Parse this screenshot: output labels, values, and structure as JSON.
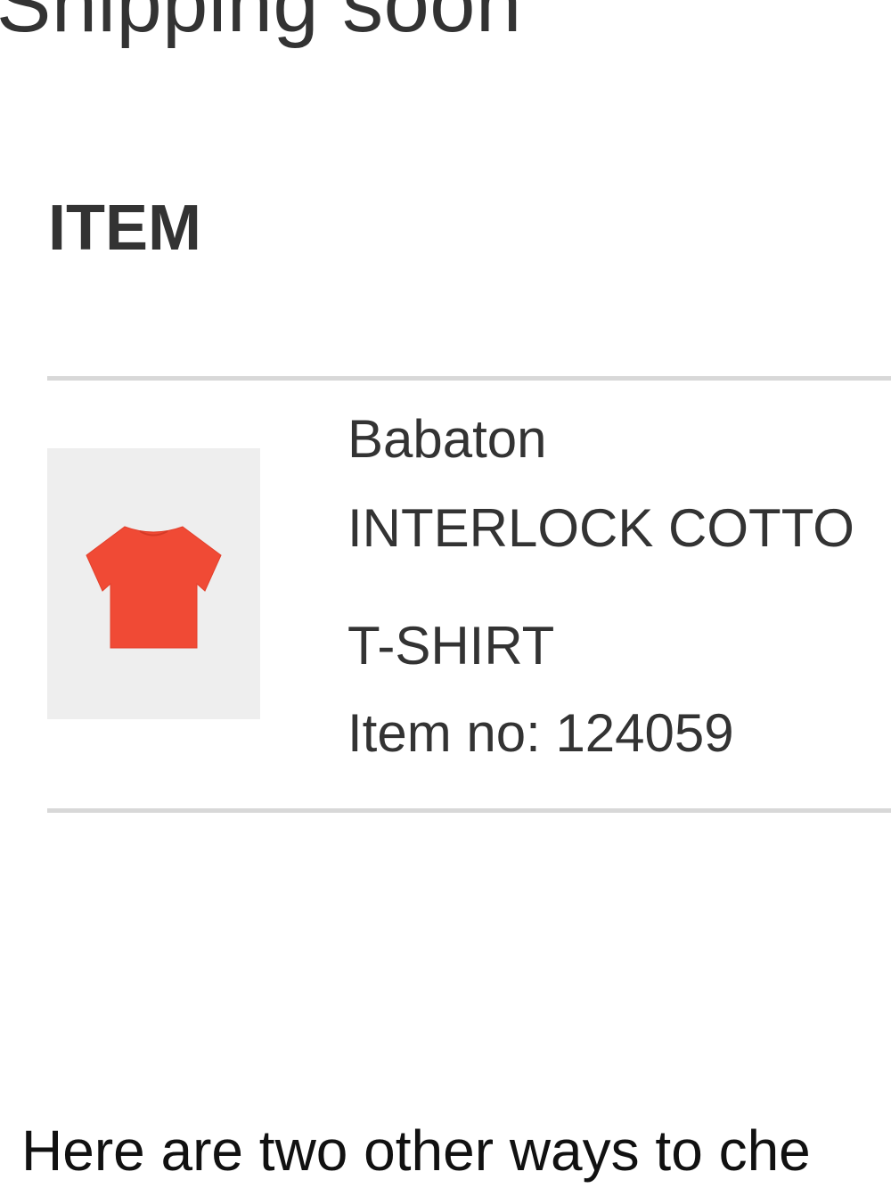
{
  "header": {
    "title": "Shipping soon"
  },
  "section": {
    "heading": "ITEM"
  },
  "item": {
    "brand": "Babaton",
    "name_line1": "INTERLOCK COTTO",
    "name_line2": "T-SHIRT",
    "item_no": "Item no: 124059",
    "image_icon": "red-tshirt-image",
    "image_background": "#eeeeee",
    "shirt_color": "#f04a35"
  },
  "footer": {
    "text": "Here are two other ways to che"
  }
}
